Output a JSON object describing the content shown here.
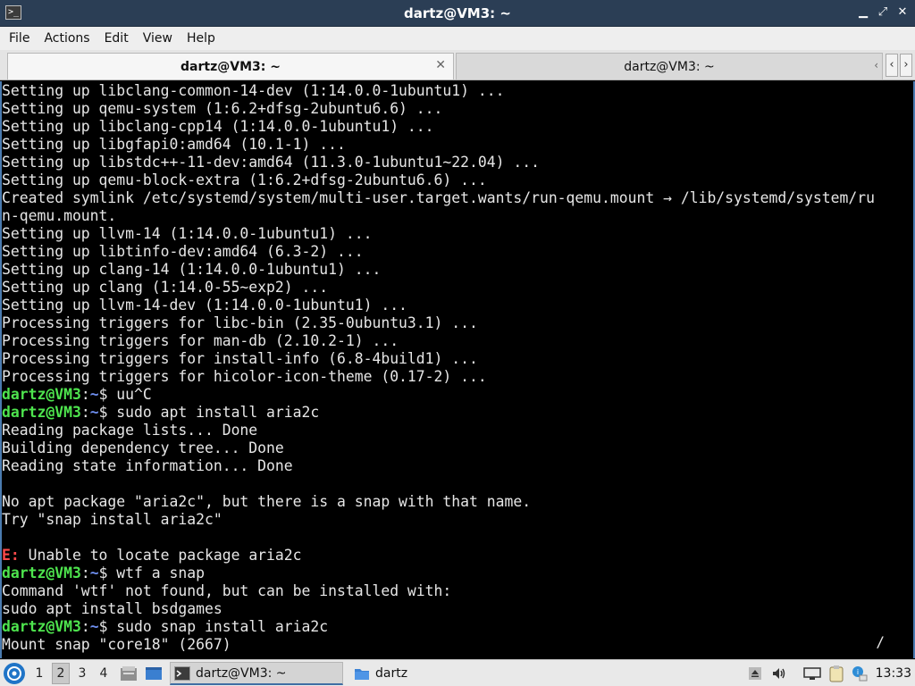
{
  "window": {
    "title": "dartz@VM3: ~",
    "icon": "terminal-icon",
    "buttons": [
      "minimize-icon",
      "maximize-icon",
      "close-icon"
    ]
  },
  "menu": [
    "File",
    "Actions",
    "Edit",
    "View",
    "Help"
  ],
  "tabs": [
    {
      "label": "dartz@VM3: ~",
      "active": true
    },
    {
      "label": "dartz@VM3: ~",
      "active": false
    }
  ],
  "terminal": {
    "lines": [
      [
        {
          "t": "Setting up libclang-common-14-dev (1:14.0.0-1ubuntu1) ..."
        }
      ],
      [
        {
          "t": "Setting up qemu-system (1:6.2+dfsg-2ubuntu6.6) ..."
        }
      ],
      [
        {
          "t": "Setting up libclang-cpp14 (1:14.0.0-1ubuntu1) ..."
        }
      ],
      [
        {
          "t": "Setting up libgfapi0:amd64 (10.1-1) ..."
        }
      ],
      [
        {
          "t": "Setting up libstdc++-11-dev:amd64 (11.3.0-1ubuntu1~22.04) ..."
        }
      ],
      [
        {
          "t": "Setting up qemu-block-extra (1:6.2+dfsg-2ubuntu6.6) ..."
        }
      ],
      [
        {
          "t": "Created symlink /etc/systemd/system/multi-user.target.wants/run-qemu.mount → /lib/systemd/system/ru"
        }
      ],
      [
        {
          "t": "n-qemu.mount."
        }
      ],
      [
        {
          "t": "Setting up llvm-14 (1:14.0.0-1ubuntu1) ..."
        }
      ],
      [
        {
          "t": "Setting up libtinfo-dev:amd64 (6.3-2) ..."
        }
      ],
      [
        {
          "t": "Setting up clang-14 (1:14.0.0-1ubuntu1) ..."
        }
      ],
      [
        {
          "t": "Setting up clang (1:14.0-55~exp2) ..."
        }
      ],
      [
        {
          "t": "Setting up llvm-14-dev (1:14.0.0-1ubuntu1) ..."
        }
      ],
      [
        {
          "t": "Processing triggers for libc-bin (2.35-0ubuntu3.1) ..."
        }
      ],
      [
        {
          "t": "Processing triggers for man-db (2.10.2-1) ..."
        }
      ],
      [
        {
          "t": "Processing triggers for install-info (6.8-4build1) ..."
        }
      ],
      [
        {
          "t": "Processing triggers for hicolor-icon-theme (0.17-2) ..."
        }
      ],
      [
        {
          "t": "dartz@VM3",
          "c": "pr"
        },
        {
          "t": ":",
          "c": ""
        },
        {
          "t": "~",
          "c": "pb"
        },
        {
          "t": "$ uu^C"
        }
      ],
      [
        {
          "t": "dartz@VM3",
          "c": "pr"
        },
        {
          "t": ":",
          "c": ""
        },
        {
          "t": "~",
          "c": "pb"
        },
        {
          "t": "$ sudo apt install aria2c"
        }
      ],
      [
        {
          "t": "Reading package lists... Done"
        }
      ],
      [
        {
          "t": "Building dependency tree... Done"
        }
      ],
      [
        {
          "t": "Reading state information... Done"
        }
      ],
      [
        {
          "t": ""
        }
      ],
      [
        {
          "t": "No apt package \"aria2c\", but there is a snap with that name."
        }
      ],
      [
        {
          "t": "Try \"snap install aria2c\""
        }
      ],
      [
        {
          "t": ""
        }
      ],
      [
        {
          "t": "E:",
          "c": "er"
        },
        {
          "t": " Unable to locate package aria2c"
        }
      ],
      [
        {
          "t": "dartz@VM3",
          "c": "pr"
        },
        {
          "t": ":",
          "c": ""
        },
        {
          "t": "~",
          "c": "pb"
        },
        {
          "t": "$ wtf a snap"
        }
      ],
      [
        {
          "t": "Command 'wtf' not found, but can be installed with:"
        }
      ],
      [
        {
          "t": "sudo apt install bsdgames"
        }
      ],
      [
        {
          "t": "dartz@VM3",
          "c": "pr"
        },
        {
          "t": ":",
          "c": ""
        },
        {
          "t": "~",
          "c": "pb"
        },
        {
          "t": "$ sudo snap install aria2c"
        }
      ],
      [
        {
          "t": "Mount snap \"core18\" (2667)"
        }
      ]
    ],
    "spinner": "/"
  },
  "taskbar": {
    "start_icon": "lubuntu-start-icon",
    "workspaces": [
      {
        "label": "1",
        "active": false
      },
      {
        "label": "2",
        "active": true
      },
      {
        "label": "3",
        "active": false
      },
      {
        "label": "4",
        "active": false
      }
    ],
    "quicklaunch": [
      "file-manager-icon",
      "show-desktop-icon"
    ],
    "tasks": [
      {
        "label": "dartz@VM3: ~",
        "icon": "terminal-icon",
        "active": true
      },
      {
        "label": "dartz",
        "icon": "folder-icon",
        "active": false
      }
    ],
    "tray": [
      "eject-icon",
      "volume-icon",
      "network-icon",
      "clipboard-icon",
      "update-notifier-icon"
    ],
    "clock": "13:33"
  }
}
